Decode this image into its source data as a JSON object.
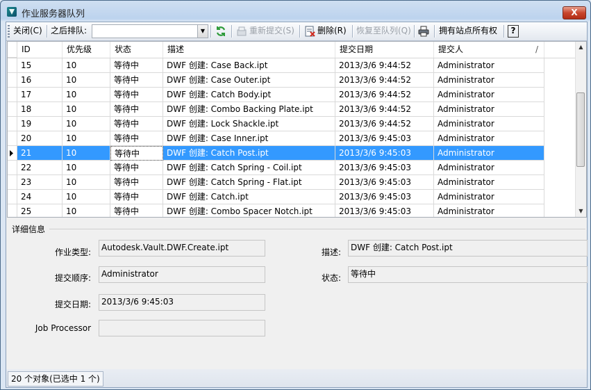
{
  "window": {
    "title": "作业服务器队列",
    "close_glyph": "X"
  },
  "toolbar": {
    "close_label": "关闭(C)",
    "requeue_after_label": "之后排队:",
    "combo_value": "",
    "resubmit_label": "重新提交(S)",
    "delete_label": "删除(R)",
    "restore_label": "恢复至队列(Q)",
    "print_label": "",
    "own_all_label": "拥有站点所有权",
    "help_label": "?"
  },
  "grid": {
    "columns": [
      "ID",
      "优先级",
      "状态",
      "描述",
      "提交日期",
      "提交人"
    ],
    "sort_indicator": "/",
    "selected_index": 6,
    "rows": [
      [
        "15",
        "10",
        "等待中",
        "DWF 创建: Case Back.ipt",
        "2013/3/6 9:44:52",
        "Administrator"
      ],
      [
        "16",
        "10",
        "等待中",
        "DWF 创建: Case Outer.ipt",
        "2013/3/6 9:44:52",
        "Administrator"
      ],
      [
        "17",
        "10",
        "等待中",
        "DWF 创建: Catch Body.ipt",
        "2013/3/6 9:44:52",
        "Administrator"
      ],
      [
        "18",
        "10",
        "等待中",
        "DWF 创建: Combo Backing Plate.ipt",
        "2013/3/6 9:44:52",
        "Administrator"
      ],
      [
        "19",
        "10",
        "等待中",
        "DWF 创建: Lock Shackle.ipt",
        "2013/3/6 9:44:52",
        "Administrator"
      ],
      [
        "20",
        "10",
        "等待中",
        "DWF 创建: Case Inner.ipt",
        "2013/3/6 9:45:03",
        "Administrator"
      ],
      [
        "21",
        "10",
        "等待中",
        "DWF 创建: Catch Post.ipt",
        "2013/3/6 9:45:03",
        "Administrator"
      ],
      [
        "22",
        "10",
        "等待中",
        "DWF 创建: Catch Spring - Coil.ipt",
        "2013/3/6 9:45:03",
        "Administrator"
      ],
      [
        "23",
        "10",
        "等待中",
        "DWF 创建: Catch Spring - Flat.ipt",
        "2013/3/6 9:45:03",
        "Administrator"
      ],
      [
        "24",
        "10",
        "等待中",
        "DWF 创建: Catch.ipt",
        "2013/3/6 9:45:03",
        "Administrator"
      ],
      [
        "25",
        "10",
        "等待中",
        "DWF 创建: Combo Spacer Notch.ipt",
        "2013/3/6 9:45:03",
        "Administrator"
      ]
    ]
  },
  "details": {
    "title": "详细信息",
    "job_type_label": "作业类型:",
    "job_type_value": "Autodesk.Vault.DWF.Create.ipt",
    "submit_order_label": "提交顺序:",
    "submit_order_value": "Administrator",
    "submit_date_label": "提交日期:",
    "submit_date_value": "2013/3/6 9:45:03",
    "processor_label": "Job Processor",
    "processor_value": "",
    "description_label": "描述:",
    "description_value": "DWF 创建: Catch Post.ipt",
    "status_label": "状态:",
    "status_value": "等待中"
  },
  "statusbar": {
    "text": "20 个对象(已选中 1 个)"
  },
  "colors": {
    "selection": "#3399ff",
    "close_button": "#c8452c"
  }
}
